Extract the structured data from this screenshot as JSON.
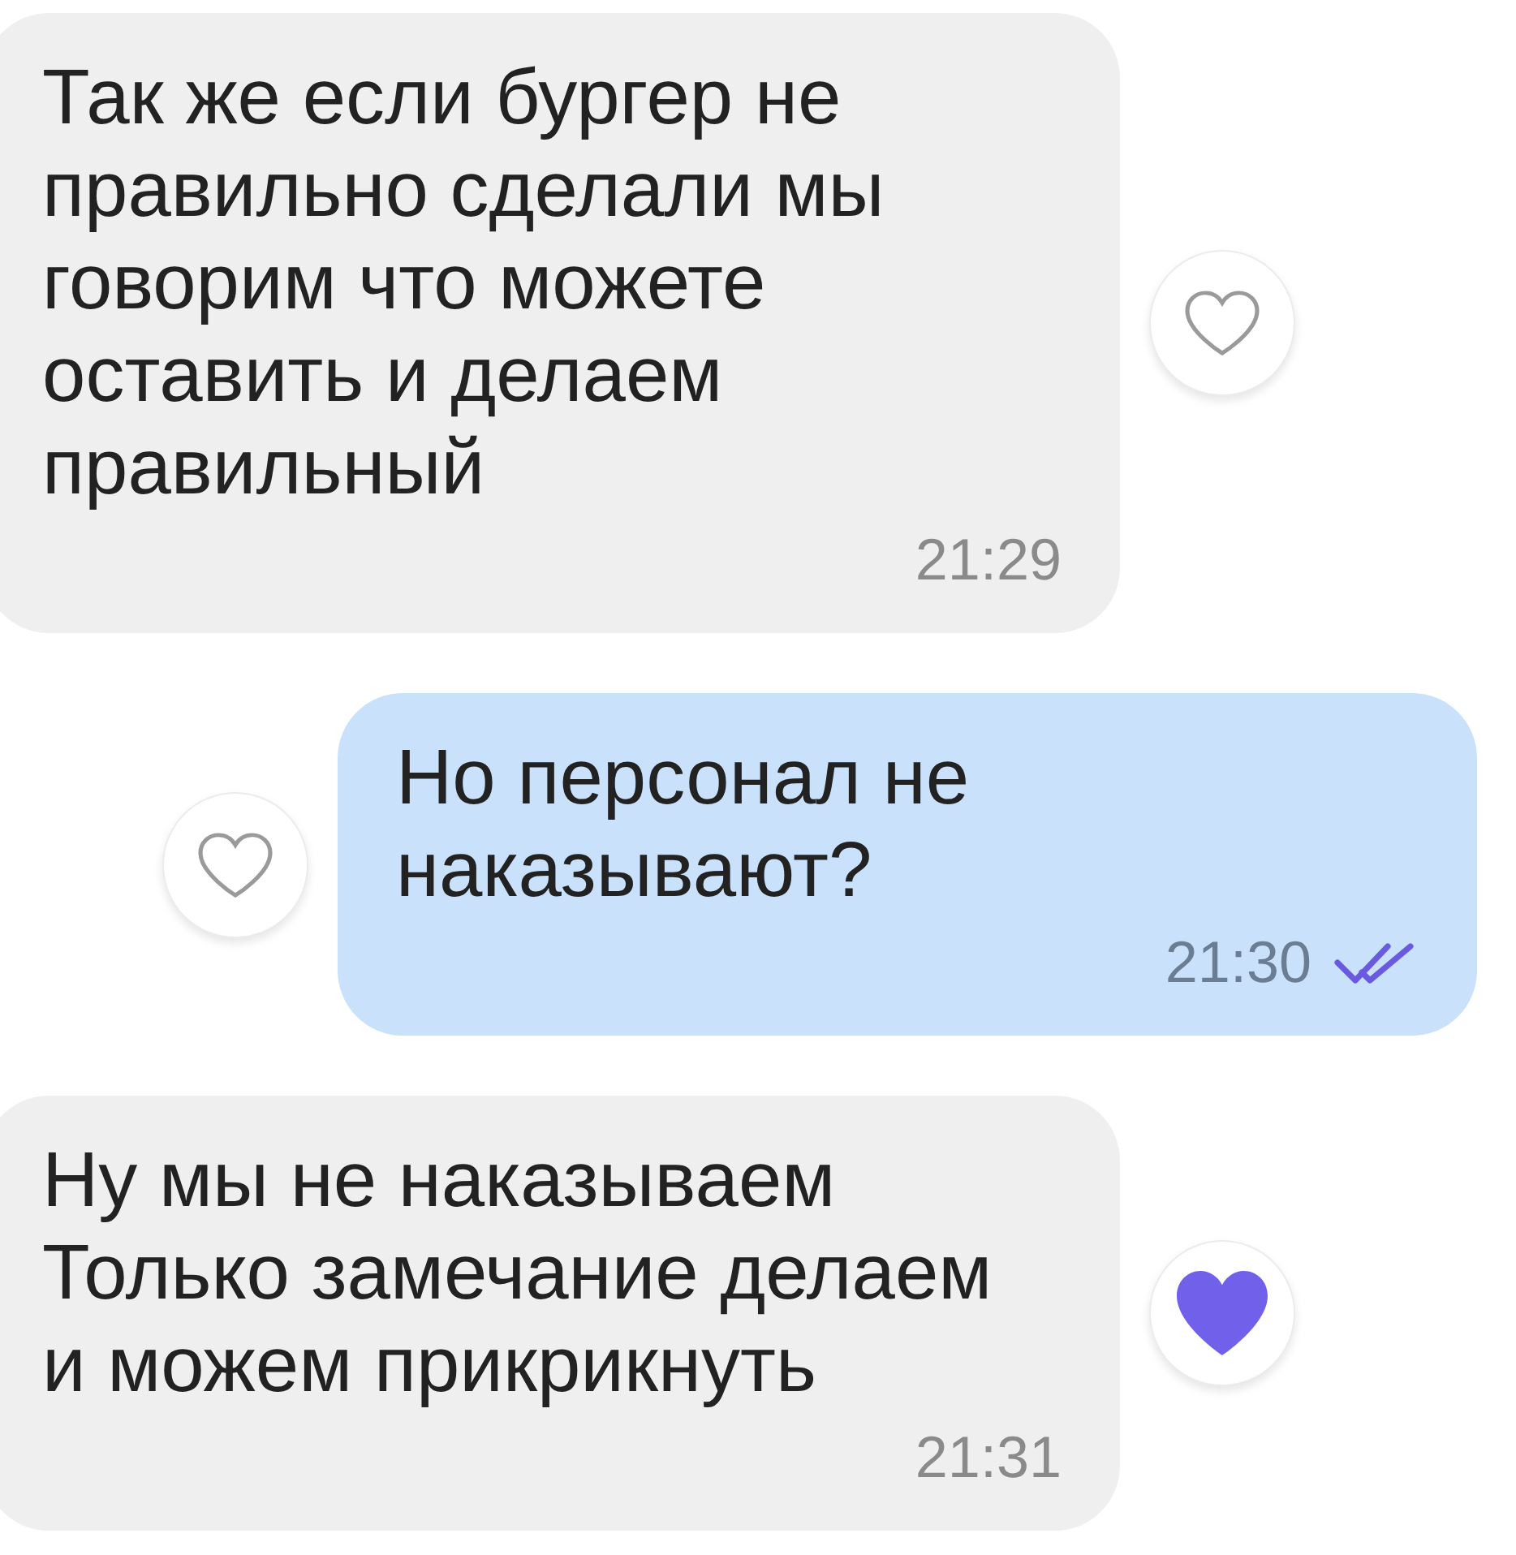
{
  "messages": [
    {
      "kind": "incoming",
      "text": "Так же если бургер не\nправильно сделали мы\nговорим что можете\nоставить и делаем\nправильный",
      "time": "21:29",
      "liked": false
    },
    {
      "kind": "outgoing",
      "text": "Но персонал не\nнаказывают?",
      "time": "21:30",
      "liked": false,
      "read": true
    },
    {
      "kind": "incoming",
      "text": "Ну мы не наказываем\nТолько замечание делаем\nи можем прикрикнуть",
      "time": "21:31",
      "liked": true
    }
  ]
}
